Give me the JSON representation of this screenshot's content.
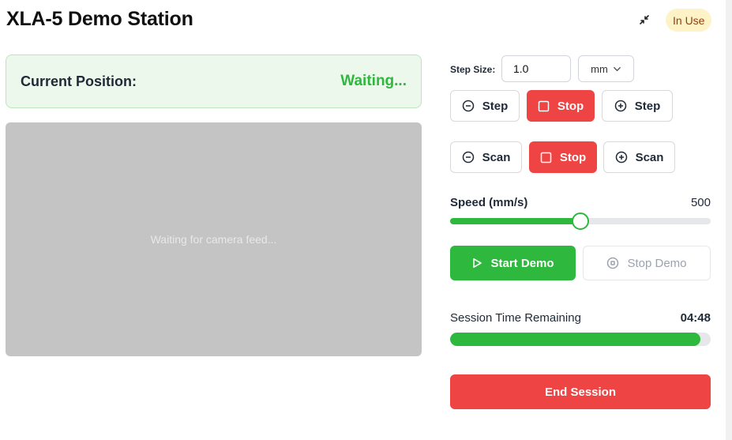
{
  "header": {
    "title": "XLA-5 Demo Station",
    "collapse_icon": "collapse-arrows-icon",
    "status": "In Use"
  },
  "position": {
    "label": "Current Position:",
    "value": "Waiting..."
  },
  "camera": {
    "placeholder": "Waiting for camera feed..."
  },
  "step_controls": {
    "step_size_label": "Step Size:",
    "step_size_value": "1.0",
    "unit": "mm",
    "step_minus_label": "Step",
    "step_stop_label": "Stop",
    "step_plus_label": "Step",
    "scan_minus_label": "Scan",
    "scan_stop_label": "Stop",
    "scan_plus_label": "Scan"
  },
  "speed": {
    "label": "Speed (mm/s)",
    "value": "500",
    "fraction": 0.5
  },
  "demo": {
    "start_label": "Start Demo",
    "stop_label": "Stop Demo"
  },
  "session": {
    "label": "Session Time Remaining",
    "time": "04:48",
    "remaining_fraction": 0.96,
    "end_label": "End Session"
  },
  "colors": {
    "accent_green": "#2eb83d",
    "danger_red": "#ef4444",
    "badge_bg": "#fef3c7",
    "badge_text": "#92400e"
  }
}
